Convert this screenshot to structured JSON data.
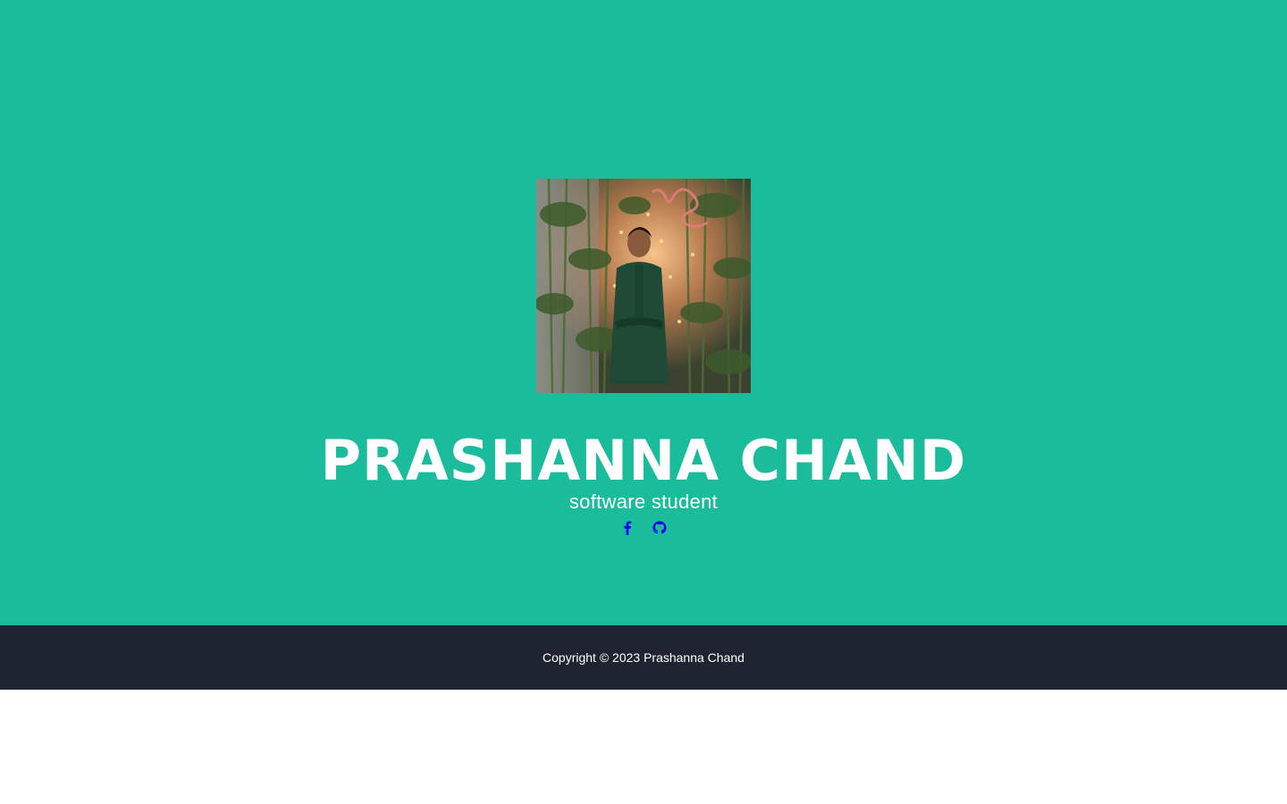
{
  "hero": {
    "name": "PRASHANNA CHAND",
    "subtitle": "software student",
    "background_color": "#1abc9c",
    "photo_alt": "profile photo",
    "social_links": [
      {
        "icon": "facebook-icon",
        "color": "#0000ee"
      },
      {
        "icon": "github-icon",
        "color": "#0000ee"
      }
    ]
  },
  "footer": {
    "copyright": "Copyright © 2023 Prashanna Chand",
    "background_color": "#1e2530"
  }
}
